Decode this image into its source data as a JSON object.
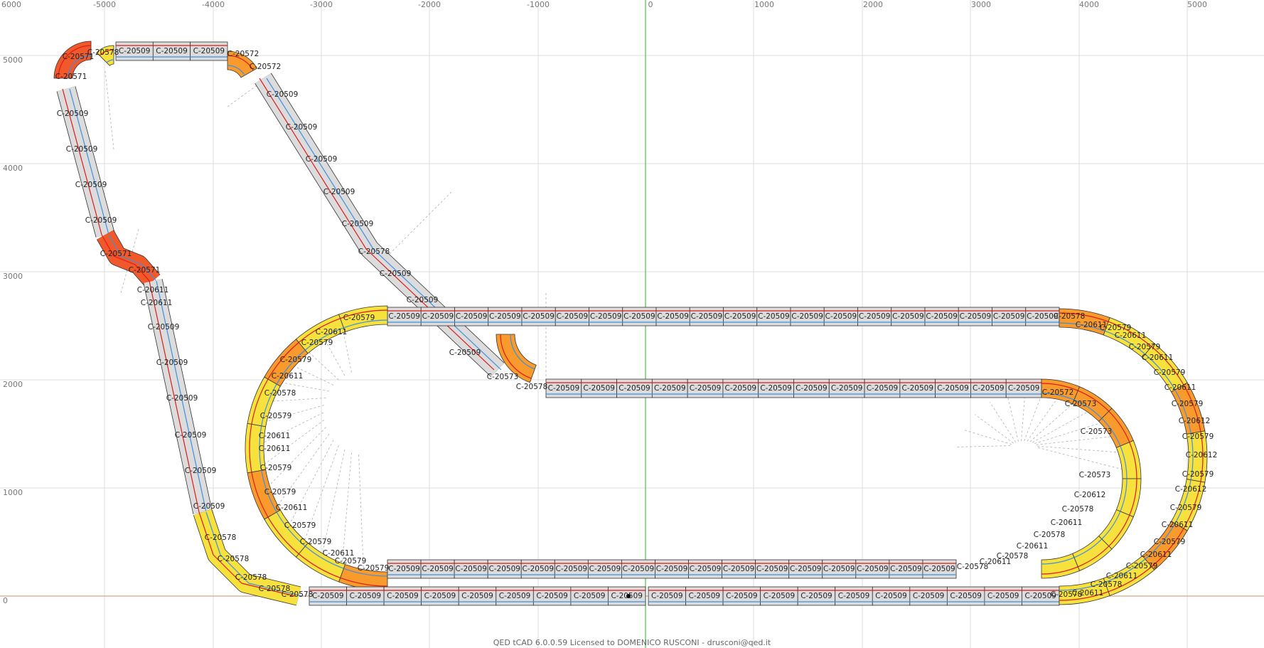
{
  "x_axis_labels": [
    "-5000",
    "-4000",
    "-3000",
    "-2000",
    "-1000",
    "0",
    "1000",
    "2000",
    "3000",
    "4000",
    "5000"
  ],
  "y_axis_labels": [
    "6000",
    "5000",
    "4000",
    "3000",
    "2000",
    "1000",
    "0"
  ],
  "piece_types": {
    "straight": "C-20509",
    "curve_r1": "C-20571",
    "curve_r2": "C-20572",
    "curve_r3": "C-20573",
    "curve_r4": "C-20578",
    "curve_r5": "C-20579",
    "curve_small": "C-20611",
    "curve_small2": "C-20612"
  },
  "colors": {
    "background": "#ffffff",
    "grid": "#dddddd",
    "x_axis": "#d9a58a",
    "y_axis": "#44c444",
    "straight_fill": "#dcdcdc",
    "curve_fill_yellow": "#f7e13c",
    "curve_fill_orange": "#f89b2c",
    "curve_fill_red": "#f1582a",
    "lane_red": "#dd1b1b",
    "lane_blue": "#3f8fe0",
    "border": "#333333"
  },
  "status": {
    "license_text": "QED tCAD 6.0.0.59 Licensed to DOMENICO RUSCONI - drusconi@qed.it"
  }
}
